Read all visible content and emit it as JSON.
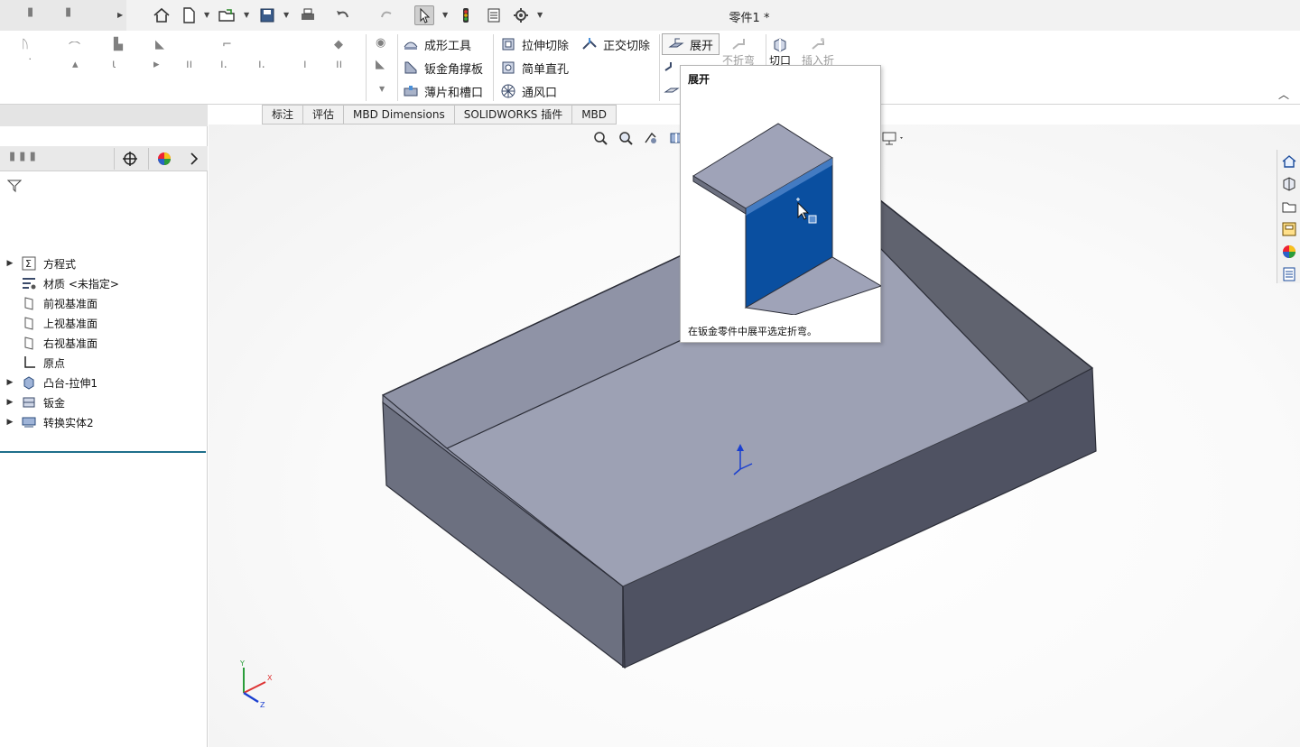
{
  "window": {
    "title": "零件1 *"
  },
  "quick_access": {
    "icons": [
      "home-icon",
      "new-document-icon",
      "open-folder-icon",
      "save-icon",
      "print-icon",
      "undo-icon",
      "select-arrow-icon",
      "traffic-light-icon",
      "file-properties-icon",
      "options-gear-icon"
    ]
  },
  "ribbon": {
    "groups": [
      {
        "items": [
          {
            "label": "成形工具",
            "icon": "forming-tool-icon",
            "enabled": true
          },
          {
            "label": "钣金角撑板",
            "icon": "gusset-icon",
            "enabled": true
          },
          {
            "label": "薄片和槽口",
            "icon": "tab-slot-icon",
            "enabled": true
          }
        ]
      },
      {
        "items": [
          {
            "label": "拉伸切除",
            "icon": "extruded-cut-icon",
            "enabled": true
          },
          {
            "label": "简单直孔",
            "icon": "simple-hole-icon",
            "enabled": true
          },
          {
            "label": "通风口",
            "icon": "vent-icon",
            "enabled": true
          },
          {
            "label": "正交切除",
            "icon": "normal-cut-icon",
            "enabled": true
          }
        ]
      },
      {
        "items": [
          {
            "label": "展开",
            "icon": "unfold-icon",
            "enabled": true,
            "selected": true
          },
          {
            "label": "不折弯",
            "icon": "no-bends-icon",
            "enabled": false
          },
          {
            "label": "切口",
            "icon": "rip-icon",
            "enabled": true
          },
          {
            "label": "插入折",
            "icon": "insert-bends-icon",
            "enabled": false
          }
        ]
      }
    ]
  },
  "tabs": [
    {
      "label": "标注"
    },
    {
      "label": "评估"
    },
    {
      "label": "MBD Dimensions"
    },
    {
      "label": "SOLIDWORKS 插件"
    },
    {
      "label": "MBD"
    }
  ],
  "feature_tree": {
    "items": [
      {
        "label": "方程式",
        "icon": "equation-icon",
        "expandable": true
      },
      {
        "label": "材质 <未指定>",
        "icon": "material-icon",
        "expandable": false
      },
      {
        "label": "前视基准面",
        "icon": "plane-icon",
        "expandable": false
      },
      {
        "label": "上视基准面",
        "icon": "plane-icon",
        "expandable": false
      },
      {
        "label": "右视基准面",
        "icon": "plane-icon",
        "expandable": false
      },
      {
        "label": "原点",
        "icon": "origin-icon",
        "expandable": false
      },
      {
        "label": "凸台-拉伸1",
        "icon": "boss-extrude-icon",
        "expandable": true
      },
      {
        "label": "钣金",
        "icon": "sheet-metal-icon",
        "expandable": true
      },
      {
        "label": "转换实体2",
        "icon": "convert-solid-icon",
        "expandable": true
      }
    ]
  },
  "tooltip": {
    "title": "展开",
    "description": "在钣金零件中展平选定折弯。"
  },
  "triad": {
    "x": "X",
    "y": "Y",
    "z": "Z"
  },
  "colors": {
    "model_face": "#8f93a6",
    "model_floor": "#9ea2b4",
    "model_wall_dark": "#505363",
    "highlight_blue": "#0a4fa0",
    "accent_line": "#1f6f8b"
  }
}
